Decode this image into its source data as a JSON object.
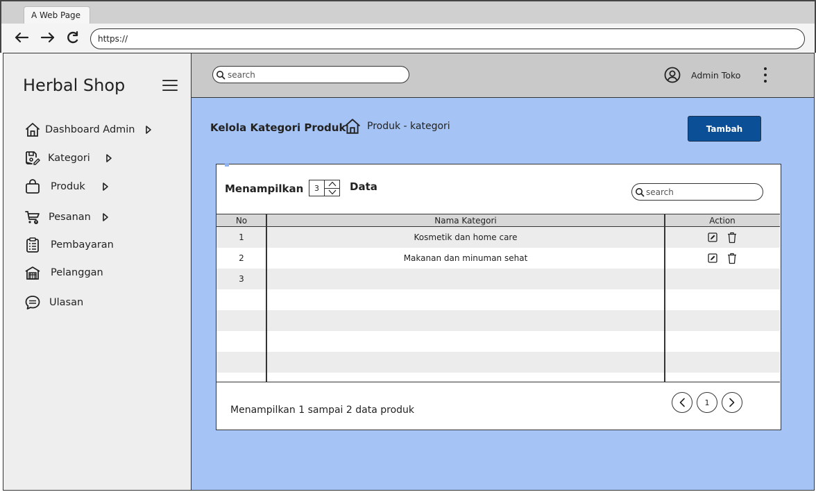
{
  "browser": {
    "tab_title": "A Web Page",
    "url": "https://"
  },
  "sidebar": {
    "brand": "Herbal Shop",
    "items": [
      {
        "label": "Dashboard Admin",
        "icon": "home-icon",
        "has_arrow": true
      },
      {
        "label": "Kategori",
        "icon": "save-edit-icon",
        "has_arrow": true
      },
      {
        "label": "Produk",
        "icon": "shopping-bag-icon",
        "has_arrow": true
      },
      {
        "label": "Pesanan",
        "icon": "cart-icon",
        "has_arrow": true
      },
      {
        "label": "Pembayaran",
        "icon": "clipboard-icon",
        "has_arrow": false
      },
      {
        "label": "Pelanggan",
        "icon": "store-icon",
        "has_arrow": false
      },
      {
        "label": "Ulasan",
        "icon": "chat-icon",
        "has_arrow": false
      }
    ]
  },
  "topbar": {
    "search_placeholder": "search",
    "user_name": "Admin Toko"
  },
  "main": {
    "title": "Kelola Kategori Produk",
    "breadcrumb": "Produk - kategori",
    "add_button": "Tambah",
    "show_label": "Menampilkan",
    "show_count": "3",
    "data_label": "Data",
    "search_placeholder": "search",
    "table": {
      "headers": [
        "No",
        "Nama Kategori",
        "Action"
      ],
      "rows": [
        {
          "no": "1",
          "name": "Kosmetik dan home care",
          "has_actions": true
        },
        {
          "no": "2",
          "name": "Makanan dan minuman sehat",
          "has_actions": true
        },
        {
          "no": "3",
          "name": "",
          "has_actions": false
        }
      ]
    },
    "footer_text": "Menampilkan 1 sampai 2 data produk",
    "pagination": {
      "current_page": "1"
    }
  }
}
